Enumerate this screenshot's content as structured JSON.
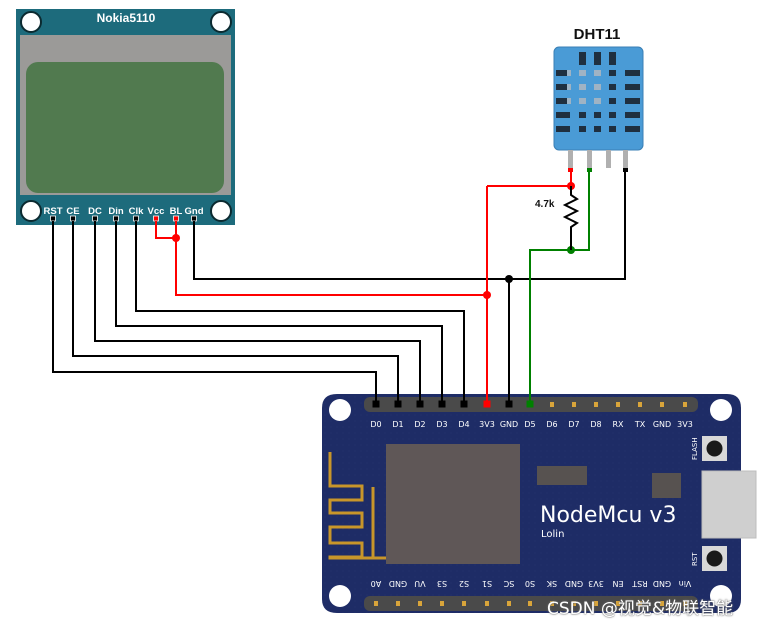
{
  "nokia": {
    "title": "Nokia5110",
    "pins": [
      "RST",
      "CE",
      "DC",
      "Din",
      "Clk",
      "Vcc",
      "BL",
      "Gnd"
    ]
  },
  "dht": {
    "title": "DHT11",
    "resistor_label": "4.7k"
  },
  "nodemcu": {
    "title": "NodeMcu v3",
    "subtitle": "Lolin",
    "flash_label": "FLASH",
    "rst_label": "RST",
    "top_pins": [
      "D0",
      "D1",
      "D2",
      "D3",
      "D4",
      "3V3",
      "GND",
      "D5",
      "D6",
      "D7",
      "D8",
      "RX",
      "TX",
      "GND",
      "3V3"
    ],
    "bottom_pins": [
      "A0",
      "GND",
      "VU",
      "S3",
      "S2",
      "S1",
      "SC",
      "S0",
      "SK",
      "GND",
      "3V3",
      "EN",
      "RST",
      "GND",
      "Vin"
    ]
  },
  "connections": [
    {
      "from": "Nokia5110.RST",
      "to": "NodeMcu.D0",
      "color": "#000000"
    },
    {
      "from": "Nokia5110.CE",
      "to": "NodeMcu.D1",
      "color": "#000000"
    },
    {
      "from": "Nokia5110.DC",
      "to": "NodeMcu.D2",
      "color": "#000000"
    },
    {
      "from": "Nokia5110.Din",
      "to": "NodeMcu.D3",
      "color": "#000000"
    },
    {
      "from": "Nokia5110.Clk",
      "to": "NodeMcu.D4",
      "color": "#000000"
    },
    {
      "from": "Nokia5110.Vcc+BL",
      "to": "NodeMcu.3V3",
      "color": "#ff0000"
    },
    {
      "from": "Nokia5110.Gnd",
      "to": "NodeMcu.GND",
      "color": "#000000"
    },
    {
      "from": "DHT11.VCC",
      "to": "NodeMcu.3V3",
      "color": "#ff0000"
    },
    {
      "from": "DHT11.DATA",
      "to": "NodeMcu.D5",
      "color": "#008000"
    },
    {
      "from": "DHT11.GND",
      "to": "NodeMcu.GND",
      "color": "#000000"
    }
  ],
  "colors": {
    "nokia_board": "#1d6b7c",
    "lcd_frame": "#9b9a98",
    "lcd_screen": "#517a4f",
    "dht_body": "#4a9bd6",
    "nodemcu_board": "#1e2c66",
    "wire_power": "#ff0000",
    "wire_data": "#008000",
    "wire_signal": "#000000"
  },
  "watermark": "CSDN @视觉&物联智能"
}
